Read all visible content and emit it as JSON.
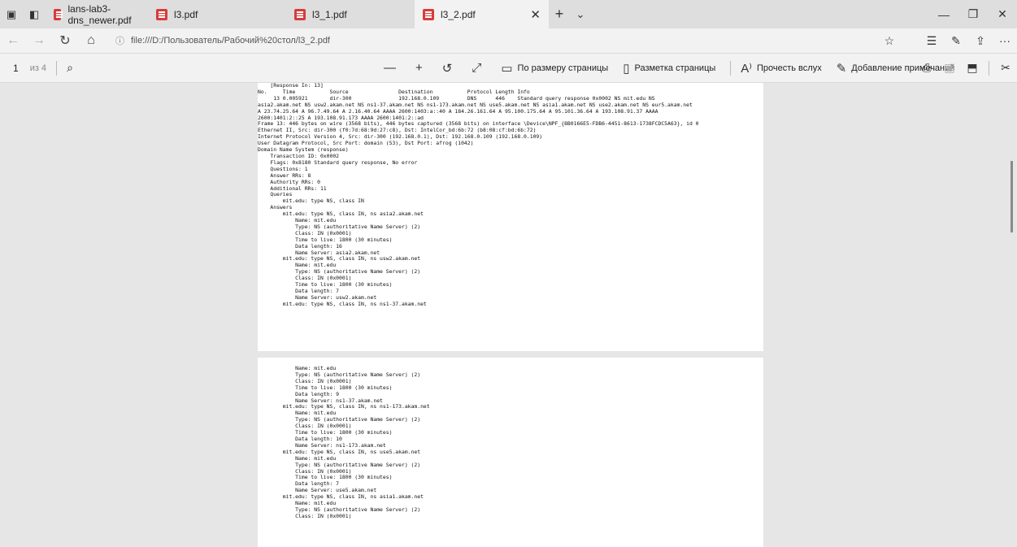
{
  "tabs": [
    {
      "label": "lans-lab3-dns_newer.pdf"
    },
    {
      "label": "l3.pdf"
    },
    {
      "label": "l3_1.pdf"
    },
    {
      "label": "l3_2.pdf"
    }
  ],
  "address": {
    "url": "file:///D:/Пользователь/Рабочий%20стол/l3_2.pdf"
  },
  "pdf_toolbar": {
    "page": "1",
    "of": "из 4",
    "fit_page": "По размеру страницы",
    "layout": "Разметка страницы",
    "read_aloud": "Прочесть вслух",
    "add_notes": "Добавление примечаний"
  },
  "page1_text": "    [Response In: 13]\nNo.     Time           Source                Destination           Protocol Length Info\n     13 0.005921       dir-300               192.168.0.109         DNS      446    Standard query response 0x0002 NS mit.edu NS\nasia2.akam.net NS usw2.akam.net NS ns1-37.akam.net NS ns1-173.akam.net NS use5.akam.net NS asia1.akam.net NS use2.akam.net NS eur5.akam.net\nA 23.74.25.64 A 96.7.49.64 A 2.16.40.64 AAAA 2600:1403:a::40 A 184.26.161.64 A 95.100.175.64 A 95.101.36.64 A 193.108.91.37 AAAA\n2600:1401:2::25 A 193.108.91.173 AAAA 2600:1401:2::ad\nFrame 13: 446 bytes on wire (3568 bits), 446 bytes captured (3568 bits) on interface \\Device\\NPF_{8B0166E5-FDB6-4451-8613-1738FCDC5A63}, id 0\nEthernet II, Src: dir-300 (f0:7d:68:9d:27:c8), Dst: IntelCor_bd:6b:72 (b8:08:cf:bd:6b:72)\nInternet Protocol Version 4, Src: dir-300 (192.168.0.1), Dst: 192.168.0.109 (192.168.0.109)\nUser Datagram Protocol, Src Port: domain (53), Dst Port: afrog (1042)\nDomain Name System (response)\n    Transaction ID: 0x0002\n    Flags: 0x8180 Standard query response, No error\n    Questions: 1\n    Answer RRs: 8\n    Authority RRs: 0\n    Additional RRs: 11\n    Queries\n        mit.edu: type NS, class IN\n    Answers\n        mit.edu: type NS, class IN, ns asia2.akam.net\n            Name: mit.edu\n            Type: NS (authoritative Name Server) (2)\n            Class: IN (0x0001)\n            Time to live: 1800 (30 minutes)\n            Data length: 16\n            Name Server: asia2.akam.net\n        mit.edu: type NS, class IN, ns usw2.akam.net\n            Name: mit.edu\n            Type: NS (authoritative Name Server) (2)\n            Class: IN (0x0001)\n            Time to live: 1800 (30 minutes)\n            Data length: 7\n            Name Server: usw2.akam.net\n        mit.edu: type NS, class IN, ns ns1-37.akam.net",
  "page2_text": "            Name: mit.edu\n            Type: NS (authoritative Name Server) (2)\n            Class: IN (0x0001)\n            Time to live: 1800 (30 minutes)\n            Data length: 9\n            Name Server: ns1-37.akam.net\n        mit.edu: type NS, class IN, ns ns1-173.akam.net\n            Name: mit.edu\n            Type: NS (authoritative Name Server) (2)\n            Class: IN (0x0001)\n            Time to live: 1800 (30 minutes)\n            Data length: 10\n            Name Server: ns1-173.akam.net\n        mit.edu: type NS, class IN, ns use5.akam.net\n            Name: mit.edu\n            Type: NS (authoritative Name Server) (2)\n            Class: IN (0x0001)\n            Time to live: 1800 (30 minutes)\n            Data length: 7\n            Name Server: use5.akam.net\n        mit.edu: type NS, class IN, ns asia1.akam.net\n            Name: mit.edu\n            Type: NS (authoritative Name Server) (2)\n            Class: IN (0x0001)"
}
